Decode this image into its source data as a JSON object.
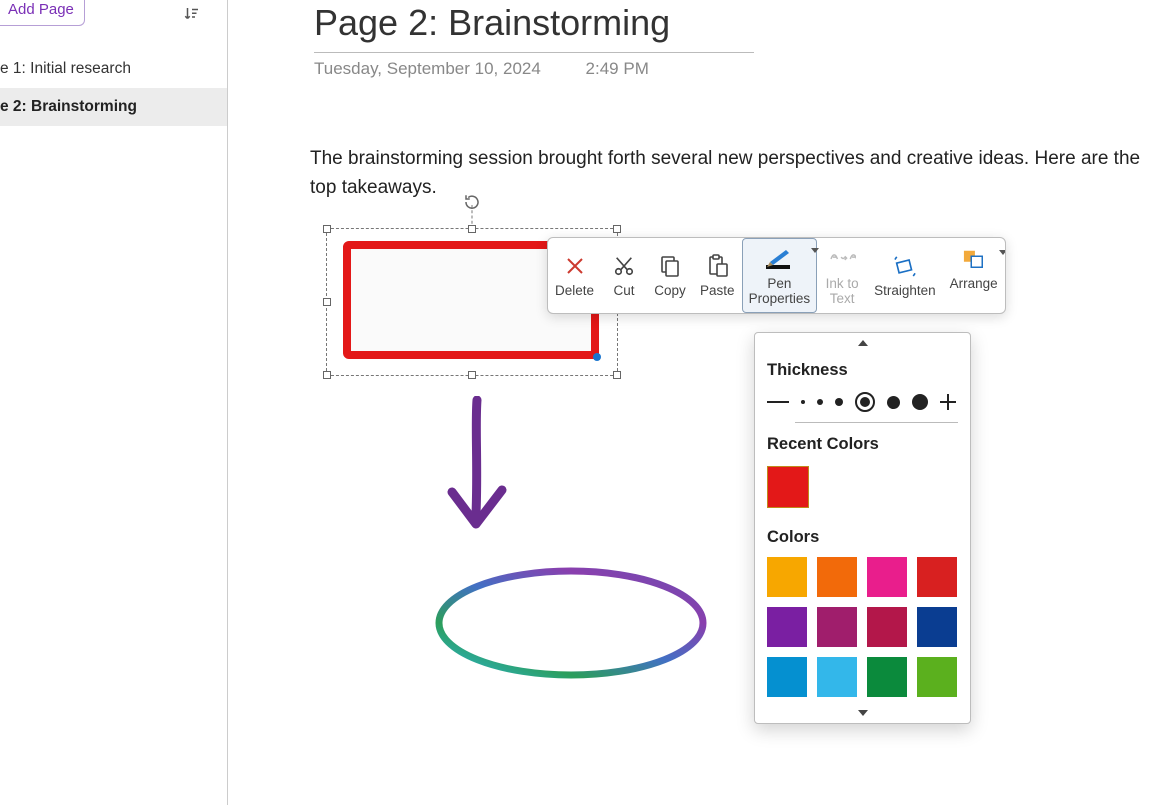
{
  "sidebar": {
    "add_page_label": "Add Page",
    "items": [
      {
        "label": "e 1: Initial research",
        "active": false
      },
      {
        "label": "e 2: Brainstorming",
        "active": true
      }
    ]
  },
  "page": {
    "title": "Page 2: Brainstorming",
    "date": "Tuesday, September 10, 2024",
    "time": "2:49 PM",
    "body": "The brainstorming session brought forth several new perspectives and creative ideas. Here are the top takeaways."
  },
  "toolbar": {
    "delete_label": "Delete",
    "cut_label": "Cut",
    "copy_label": "Copy",
    "paste_label": "Paste",
    "pen_properties_label": "Pen\nProperties",
    "ink_to_text_label": "Ink to\nText",
    "straighten_label": "Straighten",
    "arrange_label": "Arrange"
  },
  "pen_panel": {
    "thickness_label": "Thickness",
    "recent_colors_label": "Recent Colors",
    "colors_label": "Colors",
    "recent_color": "#e31818",
    "selected_thickness_index": 4,
    "palette": [
      "#f7a700",
      "#f26a0a",
      "#e91e8c",
      "#d82020",
      "#7a1fa2",
      "#a01e6c",
      "#b3174a",
      "#0a3d91",
      "#0590d0",
      "#33b7ea",
      "#0b8a3c",
      "#5bb01e"
    ]
  }
}
